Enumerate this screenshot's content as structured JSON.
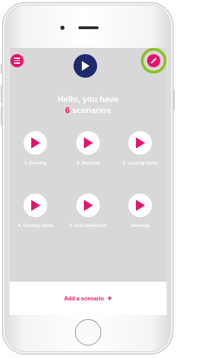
{
  "device": {
    "frame": "phone"
  },
  "app": {
    "greeting_line1": "Hello, you have",
    "scenario_count": "6",
    "scenario_word": "scenarios",
    "add_label": "Add a scenario",
    "add_icon": "+"
  },
  "scenarios": [
    {
      "label": "1. Evening"
    },
    {
      "label": "2. Morning"
    },
    {
      "label": "3. Leaving home"
    },
    {
      "label": "4. Coming home"
    },
    {
      "label": "5. Sun protection"
    },
    {
      "label": "morning"
    }
  ],
  "colors": {
    "accent": "#e5136c",
    "logo_bg": "#1f2a6d",
    "highlight_ring": "#8dbf22",
    "screen_bg": "#d8d8d8"
  },
  "icons": {
    "menu": "hamburger-icon",
    "logo": "play-logo-icon",
    "edit": "pencil-icon",
    "scenario": "play-icon"
  }
}
